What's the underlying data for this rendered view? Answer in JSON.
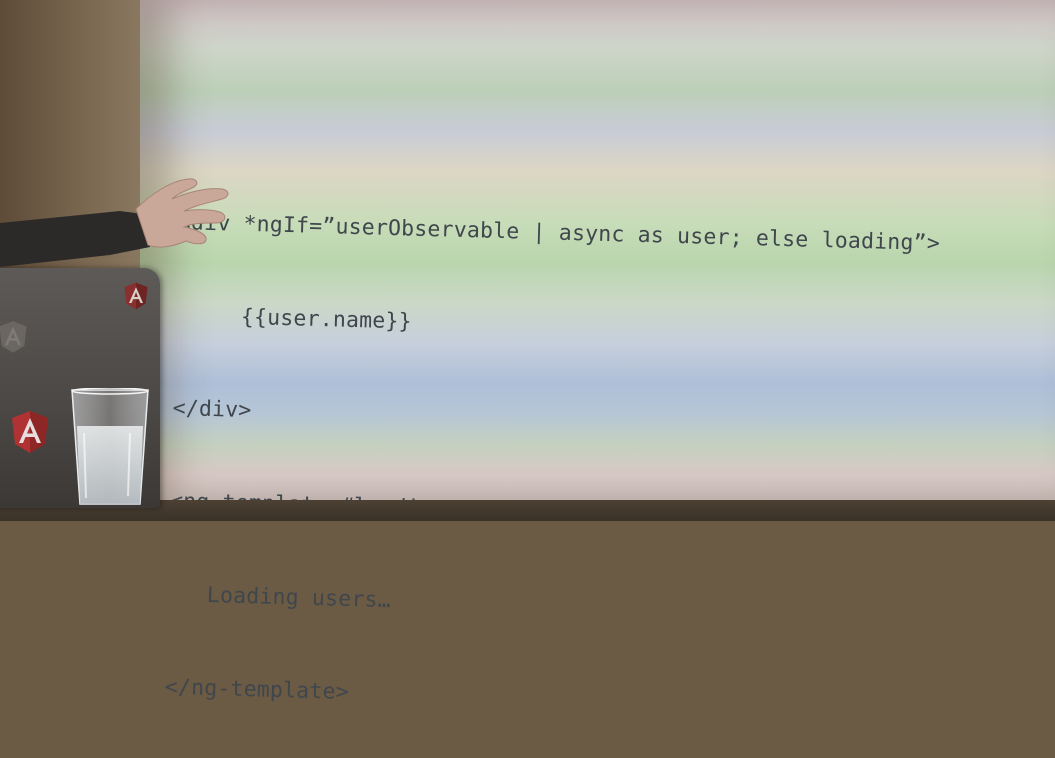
{
  "slide": {
    "code_lines": [
      "<div *ngIf=”userObservable | async as user; else loading”>",
      "     {{user.name}}",
      "</div>",
      "<ng-template #loading>",
      "   Loading users…",
      "</ng-template>"
    ],
    "code_color": "#3f464c"
  },
  "scene": {
    "laptop_stickers": [
      "angular-logo-icon",
      "angular-logo-icon",
      "angular-logo-icon"
    ],
    "objects": [
      "laptop",
      "glass-cup",
      "presenter-hand"
    ]
  }
}
